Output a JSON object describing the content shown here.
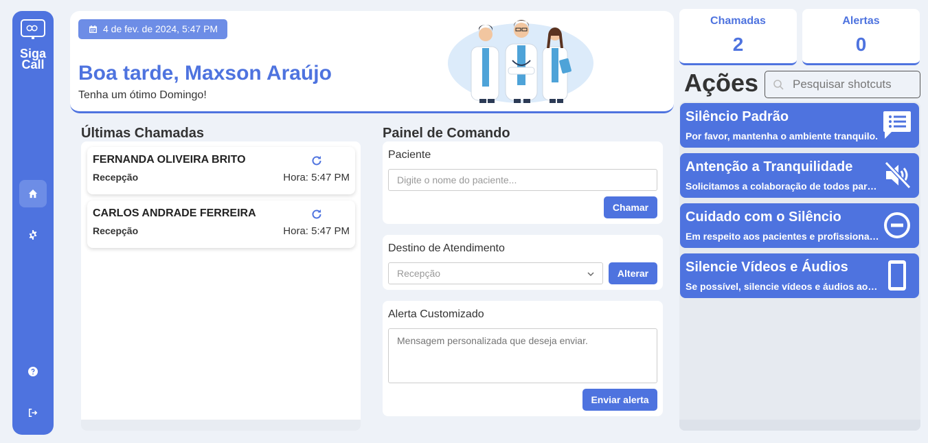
{
  "sidebar": {
    "logo_line1": "Siga",
    "logo_line2": "Call",
    "items": [
      {
        "name": "home",
        "icon": "home-icon"
      },
      {
        "name": "settings",
        "icon": "gear-icon"
      },
      {
        "name": "help",
        "icon": "question-icon"
      },
      {
        "name": "logout",
        "icon": "logout-icon"
      }
    ]
  },
  "header": {
    "date": "4 de fev. de 2024, 5:47 PM",
    "greeting": "Boa tarde, Maxson Araújo",
    "subtitle": "Tenha um ótimo Domingo!"
  },
  "calls": {
    "title": "Últimas Chamadas",
    "items": [
      {
        "name": "FERNANDA OLIVEIRA BRITO",
        "location": "Recepção",
        "time": "Hora: 5:47 PM"
      },
      {
        "name": "CARLOS ANDRADE FERREIRA",
        "location": "Recepção",
        "time": "Hora: 5:47 PM"
      }
    ]
  },
  "command": {
    "title": "Painel de Comando",
    "patient_label": "Paciente",
    "patient_placeholder": "Digite o nome do paciente...",
    "call_button": "Chamar",
    "destination_label": "Destino de Atendimento",
    "destination_value": "Recepção",
    "change_button": "Alterar",
    "alert_label": "Alerta Customizado",
    "alert_placeholder": "Mensagem personalizada que deseja enviar.",
    "send_button": "Enviar alerta"
  },
  "stats": {
    "calls_label": "Chamadas",
    "calls_value": "2",
    "alerts_label": "Alertas",
    "alerts_value": "0"
  },
  "actions": {
    "title": "Ações",
    "search_placeholder": "Pesquisar shotcuts",
    "items": [
      {
        "title": "Silêncio Padrão",
        "desc": "Por favor, mantenha o ambiente tranquilo.",
        "icon": "message-list-icon"
      },
      {
        "title": "Antenção a Tranquilidade",
        "desc": "Solicitamos a colaboração de todos para manter o silêncio.",
        "icon": "volume-mute-icon"
      },
      {
        "title": "Cuidado com o Silêncio",
        "desc": "Em respeito aos pacientes e profissionais.",
        "icon": "minus-circle-icon"
      },
      {
        "title": "Silencie Vídeos e Áudios",
        "desc": "Se possível, silencie vídeos e áudios ao redor.",
        "icon": "phone-icon"
      }
    ]
  },
  "colors": {
    "accent": "#4e73df",
    "accent_light": "#6d8de6",
    "background": "#eef2f8"
  }
}
